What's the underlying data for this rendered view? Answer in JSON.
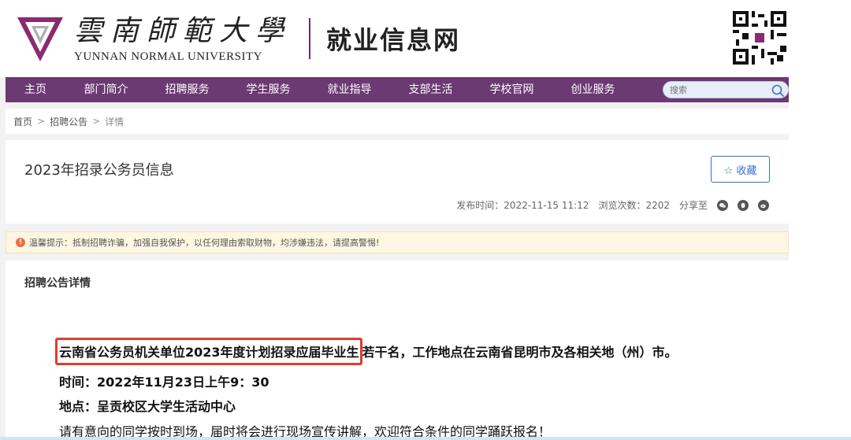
{
  "header": {
    "logo_cn": "雲南師範大學",
    "logo_en": "YUNNAN NORMAL UNIVERSITY",
    "site_title": "就业信息网"
  },
  "nav": {
    "items": [
      {
        "label": "主页"
      },
      {
        "label": "部门简介"
      },
      {
        "label": "招聘服务"
      },
      {
        "label": "学生服务"
      },
      {
        "label": "就业指导"
      },
      {
        "label": "支部生活"
      },
      {
        "label": "学校官网"
      },
      {
        "label": "创业服务"
      }
    ],
    "search_placeholder": "搜索"
  },
  "breadcrumb": {
    "home": "首页",
    "section": "招聘公告",
    "current": "详情"
  },
  "article": {
    "title": "2023年招录公务员信息",
    "fav_label": "☆ 收藏",
    "publish": "发布时间：2022-11-15 11:12",
    "views": "浏览次数：2202",
    "share": "分享至"
  },
  "tip": {
    "text": "温馨提示：抵制招聘诈骗，加强自我保护，以任何理由索取财物，均涉嫌违法，请提高警惕!"
  },
  "content": {
    "section_title": "招聘公告详情",
    "highlight_text": "云南省公务员机关单位2023年度计划招录应届毕业生",
    "main_rest": "若干名，工作地点在云南省昆明市及各相关地（州）市。",
    "time_line": "时间：2022年11月23日上午9：30",
    "place_line": "地点：呈贡校区大学生活动中心",
    "invite_line": "请有意向的同学按时到场，届时将会进行现场宣传讲解，欢迎符合条件的同学踊跃报名！"
  },
  "colors": {
    "nav_bg": "#6b3a72",
    "highlight_border": "#e23b2e",
    "accent_blue": "#3b6fc4"
  }
}
